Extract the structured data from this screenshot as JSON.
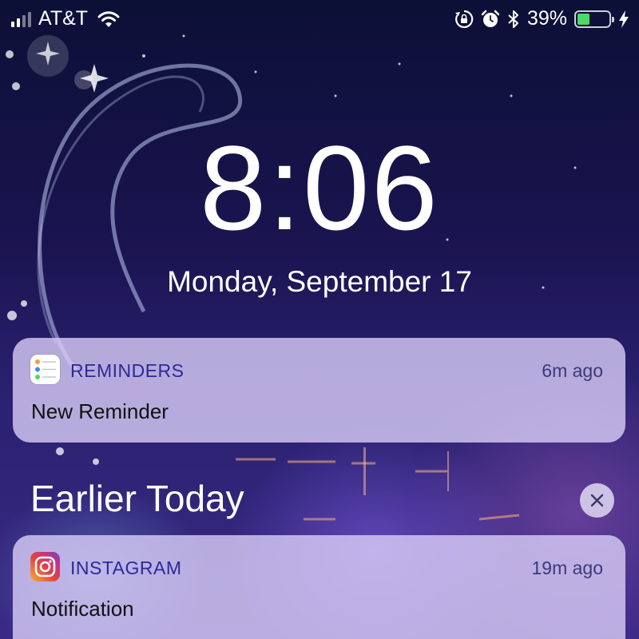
{
  "status_bar": {
    "carrier": "AT&T",
    "battery_percent": "39%",
    "battery_level": 0.39,
    "icons": [
      "signal-icon",
      "wifi-icon",
      "rotation-lock-icon",
      "alarm-icon",
      "bluetooth-icon",
      "battery-icon",
      "charging-bolt-icon"
    ]
  },
  "lock_screen": {
    "time": "8:06",
    "date": "Monday, September 17"
  },
  "notifications": [
    {
      "app": "REMINDERS",
      "age": "6m ago",
      "message": "New Reminder",
      "icon": "reminders-app-icon"
    },
    {
      "app": "INSTAGRAM",
      "age": "19m ago",
      "message": "Notification",
      "icon": "instagram-app-icon"
    }
  ],
  "earlier_section": {
    "title": "Earlier Today",
    "clear_icon": "close-icon"
  },
  "colors": {
    "battery_fill": "#4cd964",
    "notification_bg": "#dacef8",
    "app_name": "#2a2a9a"
  }
}
